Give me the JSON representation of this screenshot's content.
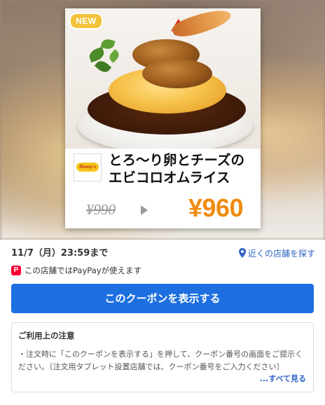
{
  "coupon": {
    "badge": "NEW",
    "brand_logo_text": "Denny's",
    "title_line1": "とろ〜り卵とチーズの",
    "title_line2": "エビコロオムライス",
    "original_price": "¥990",
    "discount_price": "¥960",
    "accent_color": "#f08c10"
  },
  "info": {
    "deadline": "11/7（月）23:59まで",
    "nearby_link": "近くの店舗を探す",
    "paypay_icon": "P",
    "paypay_text": "この店舗ではPayPayが使えます"
  },
  "action": {
    "show_coupon_label": "このクーポンを表示する",
    "button_color": "#1d6fe0"
  },
  "notice": {
    "title": "ご利用上の注意",
    "body": "・注文時に「このクーポンを表示する」を押して、クーポン番号の画面をご提示ください。〔注文用タブレット設置店舗では、クーポン番号をご入力ください〕",
    "see_all": "...すべて見る"
  },
  "icons": {
    "arrow": "right-triangle-icon",
    "location": "location-pin-icon",
    "paypay": "paypay-icon"
  }
}
